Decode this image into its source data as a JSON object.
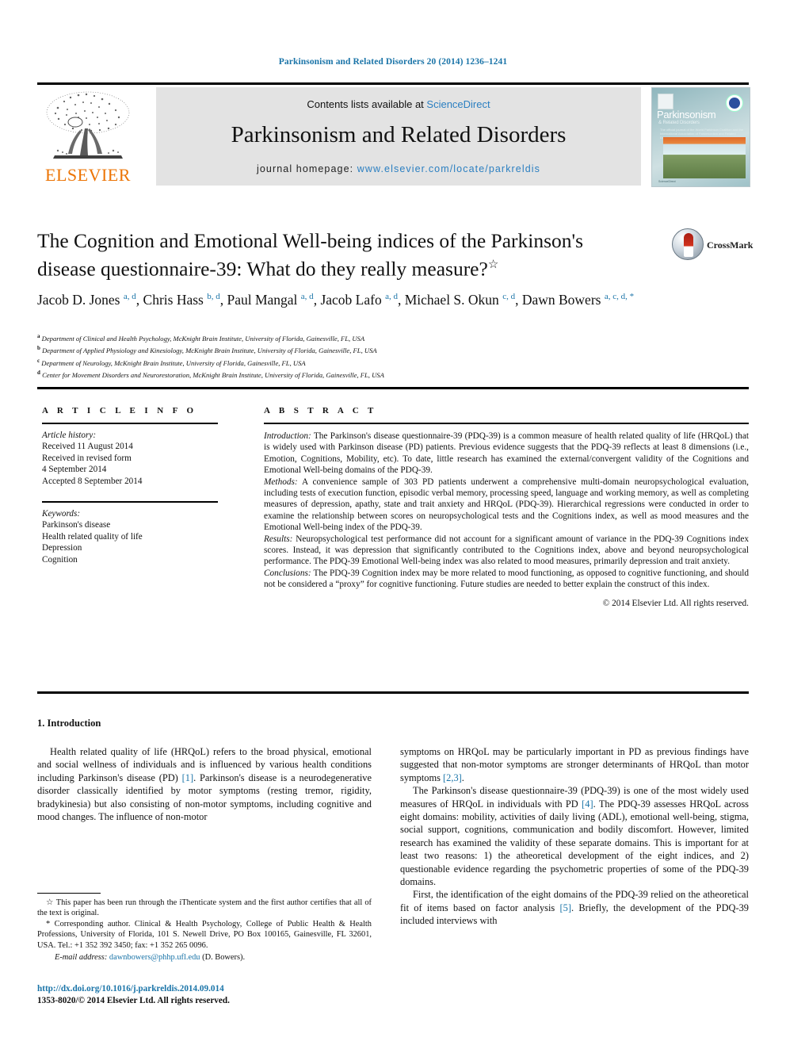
{
  "running_head": "Parkinsonism and Related Disorders 20 (2014) 1236–1241",
  "masthead": {
    "publisher": "ELSEVIER",
    "contents_prefix": "Contents lists available at ",
    "contents_link": "ScienceDirect",
    "journal_title": "Parkinsonism and Related Disorders",
    "homepage_label": "journal homepage: ",
    "homepage_url": "www.elsevier.com/locate/parkreldis",
    "cover": {
      "title": "Parkinsonism",
      "subtitle": "& Related Disorders",
      "tagline": "The official journal of the World Parkinson Coalition and the International Association of Parkinsonism and Related Disorders",
      "footer": "ScienceDirect"
    }
  },
  "article": {
    "title": "The Cognition and Emotional Well-being indices of the Parkinson's disease questionnaire-39: What do they really measure?",
    "title_marker": "☆",
    "crossmark_label": "CrossMark",
    "authors": [
      {
        "name": "Jacob D. Jones",
        "sup": "a, d"
      },
      {
        "name": "Chris Hass",
        "sup": "b, d"
      },
      {
        "name": "Paul Mangal",
        "sup": "a, d"
      },
      {
        "name": "Jacob Lafo",
        "sup": "a, d"
      },
      {
        "name": "Michael S. Okun",
        "sup": "c, d"
      },
      {
        "name": "Dawn Bowers",
        "sup": "a, c, d, *"
      }
    ],
    "affiliations": [
      {
        "marker": "a",
        "text": "Department of Clinical and Health Psychology, McKnight Brain Institute, University of Florida, Gainesville, FL, USA"
      },
      {
        "marker": "b",
        "text": "Department of Applied Physiology and Kinesiology, McKnight Brain Institute, University of Florida, Gainesville, FL, USA"
      },
      {
        "marker": "c",
        "text": "Department of Neurology, McKnight Brain Institute, University of Florida, Gainesville, FL, USA"
      },
      {
        "marker": "d",
        "text": "Center for Movement Disorders and Neurorestoration, McKnight Brain Institute, University of Florida, Gainesville, FL, USA"
      }
    ]
  },
  "article_info": {
    "heading": "A R T I C L E  I N F O",
    "history_label": "Article history:",
    "history_lines": [
      "Received 11 August 2014",
      "Received in revised form",
      "4 September 2014",
      "Accepted 8 September 2014"
    ],
    "keywords_label": "Keywords:",
    "keywords": [
      "Parkinson's disease",
      "Health related quality of life",
      "Depression",
      "Cognition"
    ]
  },
  "abstract": {
    "heading": "A B S T R A C T",
    "sections": [
      {
        "label": "Introduction:",
        "text": " The Parkinson's disease questionnaire-39 (PDQ-39) is a common measure of health related quality of life (HRQoL) that is widely used with Parkinson disease (PD) patients. Previous evidence suggests that the PDQ-39 reflects at least 8 dimensions (i.e., Emotion, Cognitions, Mobility, etc). To date, little research has examined the external/convergent validity of the Cognitions and Emotional Well-being domains of the PDQ-39."
      },
      {
        "label": "Methods:",
        "text": " A convenience sample of 303 PD patients underwent a comprehensive multi-domain neuropsychological evaluation, including tests of execution function, episodic verbal memory, processing speed, language and working memory, as well as completing measures of depression, apathy, state and trait anxiety and HRQoL (PDQ-39). Hierarchical regressions were conducted in order to examine the relationship between scores on neuropsychological tests and the Cognitions index, as well as mood measures and the Emotional Well-being index of the PDQ-39."
      },
      {
        "label": "Results:",
        "text": " Neuropsychological test performance did not account for a significant amount of variance in the PDQ-39 Cognitions index scores. Instead, it was depression that significantly contributed to the Cognitions index, above and beyond neuropsychological performance. The PDQ-39 Emotional Well-being index was also related to mood measures, primarily depression and trait anxiety."
      },
      {
        "label": "Conclusions:",
        "text": " The PDQ-39 Cognition index may be more related to mood functioning, as opposed to cognitive functioning, and should not be considered a “proxy” for cognitive functioning. Future studies are needed to better explain the construct of this index."
      }
    ],
    "copyright": "© 2014 Elsevier Ltd. All rights reserved."
  },
  "body": {
    "section_heading": "1.  Introduction",
    "left_paragraphs": [
      "Health related quality of life (HRQoL) refers to the broad physical, emotional and social wellness of individuals and is influenced by various health conditions including Parkinson's disease (PD) [1]. Parkinson's disease is a neurodegenerative disorder classically identified by motor symptoms (resting tremor, rigidity, bradykinesia) but also consisting of non-motor symptoms, including cognitive and mood changes. The influence of non-motor"
    ],
    "right_paragraphs": [
      "symptoms on HRQoL may be particularly important in PD as previous findings have suggested that non-motor symptoms are stronger determinants of HRQoL than motor symptoms [2,3].",
      "The Parkinson's disease questionnaire-39 (PDQ-39) is one of the most widely used measures of HRQoL in individuals with PD [4]. The PDQ-39 assesses HRQoL across eight domains: mobility, activities of daily living (ADL), emotional well-being, stigma, social support, cognitions, communication and bodily discomfort. However, limited research has examined the validity of these separate domains. This is important for at least two reasons: 1) the atheoretical development of the eight indices, and 2) questionable evidence regarding the psychometric properties of some of the PDQ-39 domains.",
      "First, the identification of the eight domains of the PDQ-39 relied on the atheoretical fit of items based on factor analysis [5]. Briefly, the development of the PDQ-39 included interviews with"
    ]
  },
  "footnotes": {
    "star_note": "☆ This paper has been run through the iThenticate system and the first author certifies that all of the text is original.",
    "corresponding_note": "* Corresponding author. Clinical & Health Psychology, College of Public Health & Health Professions, University of Florida, 101 S. Newell Drive, PO Box 100165, Gainesville, FL 32601, USA. Tel.: +1 352 392 3450; fax: +1 352 265 0096.",
    "email_label": "E-mail address:",
    "email": "dawnbowers@phhp.ufl.edu",
    "email_suffix": "(D. Bowers)."
  },
  "footer": {
    "doi": "http://dx.doi.org/10.1016/j.parkreldis.2014.09.014",
    "issn_line": "1353-8020/© 2014 Elsevier Ltd. All rights reserved."
  },
  "colors": {
    "link_blue": "#1a74a8",
    "sciencedirect_blue": "#2b7fc1",
    "elsevier_orange": "#ec7404",
    "banner_gray": "#e3e3e3"
  }
}
